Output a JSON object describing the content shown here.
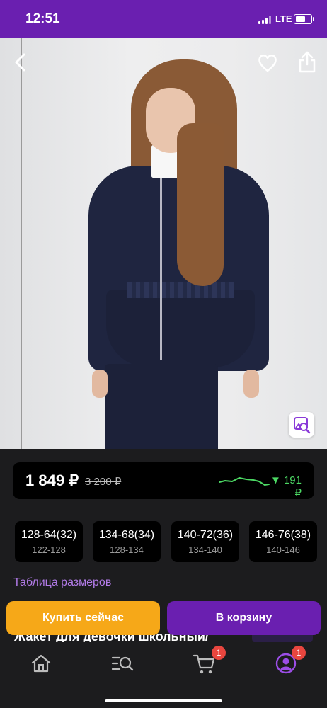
{
  "status_bar": {
    "time": "12:51",
    "network": "LTE"
  },
  "product": {
    "price": "1 849 ₽",
    "old_price": "3 200 ₽",
    "price_drop": "▼ 191 ₽",
    "title_partial": "Жакет для девочки школьный/",
    "badge_partial": "-----"
  },
  "sizes": [
    {
      "label": "128-64(32)",
      "height": "122-128"
    },
    {
      "label": "134-68(34)",
      "height": "128-134"
    },
    {
      "label": "140-72(36)",
      "height": "134-140"
    },
    {
      "label": "146-76(38)",
      "height": "140-146"
    }
  ],
  "size_table_link": "Таблица размеров",
  "actions": {
    "buy_now": "Купить сейчас",
    "add_to_cart": "В корзину"
  },
  "tabbar": {
    "cart_badge": "1",
    "profile_badge": "1"
  },
  "colors": {
    "brand_purple": "#6a1fb0",
    "buy_orange": "#f6a818",
    "price_drop_green": "#4cd964",
    "link_purple": "#b27be8"
  },
  "icons": [
    "back-arrow-icon",
    "heart-icon",
    "share-icon",
    "photo-search-icon",
    "home-icon",
    "catalog-search-icon",
    "cart-icon",
    "profile-icon"
  ]
}
